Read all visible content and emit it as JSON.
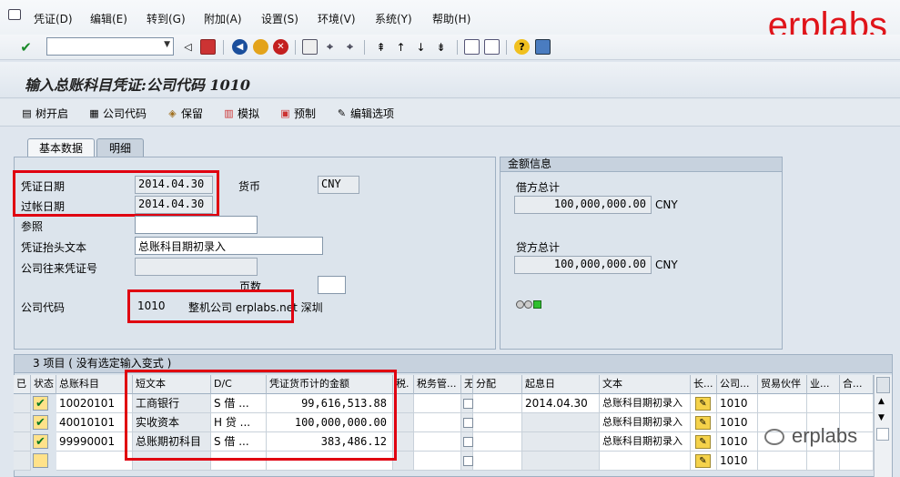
{
  "menubar": {
    "items": [
      "凭证(D)",
      "编辑(E)",
      "转到(G)",
      "附加(A)",
      "设置(S)",
      "环境(V)",
      "系统(Y)",
      "帮助(H)"
    ],
    "brand": "erplabs"
  },
  "screen_title": "输入总账科目凭证:公司代码 1010",
  "app_toolbar": {
    "buttons": [
      "树开启",
      "公司代码",
      "保留",
      "模拟",
      "预制",
      "编辑选项"
    ]
  },
  "tabs": [
    "基本数据",
    "明细"
  ],
  "basic_data": {
    "doc_date_label": "凭证日期",
    "doc_date": "2014.04.30",
    "posting_date_label": "过帐日期",
    "posting_date": "2014.04.30",
    "currency_label": "货币",
    "currency": "CNY",
    "reference_label": "参照",
    "reference": "",
    "header_text_label": "凭证抬头文本",
    "header_text": "总账科目期初录入",
    "cross_cc_label": "公司往来凭证号",
    "page_label": "页数",
    "company_code_label": "公司代码",
    "company_code": "1010",
    "company_name": "整机公司 erplabs.net 深圳"
  },
  "amount_info": {
    "title": "金额信息",
    "debit_label": "借方总计",
    "debit_total": "100,000,000.00",
    "debit_currency": "CNY",
    "credit_label": "贷方总计",
    "credit_total": "100,000,000.00",
    "credit_currency": "CNY"
  },
  "items_table": {
    "title": "3 项目 ( 没有选定输入变式 )",
    "columns": [
      "已",
      "状态",
      "总账科目",
      "短文本",
      "D/C",
      "凭证货币计的金额",
      "税.",
      "税务管...",
      "无",
      "分配",
      "起息日",
      "文本",
      "长...",
      "公司...",
      "贸易伙伴",
      "业...",
      "合..."
    ],
    "rows": [
      {
        "account": "10020101",
        "short_text": "工商银行",
        "dc": "S 借 ...",
        "amount": "99,616,513.88",
        "value_date": "2014.04.30",
        "text": "总账科目期初录入",
        "company": "1010"
      },
      {
        "account": "40010101",
        "short_text": "实收资本",
        "dc": "H 贷 ...",
        "amount": "100,000,000.00",
        "value_date": "",
        "text": "总账科目期初录入",
        "company": "1010"
      },
      {
        "account": "99990001",
        "short_text": "总账期初科目",
        "dc": "S 借 ...",
        "amount": "383,486.12",
        "value_date": "",
        "text": "总账科目期初录入",
        "company": "1010"
      },
      {
        "account": "",
        "short_text": "",
        "dc": "",
        "amount": "",
        "value_date": "",
        "text": "",
        "company": "1010"
      }
    ]
  },
  "watermark": "erplabs"
}
